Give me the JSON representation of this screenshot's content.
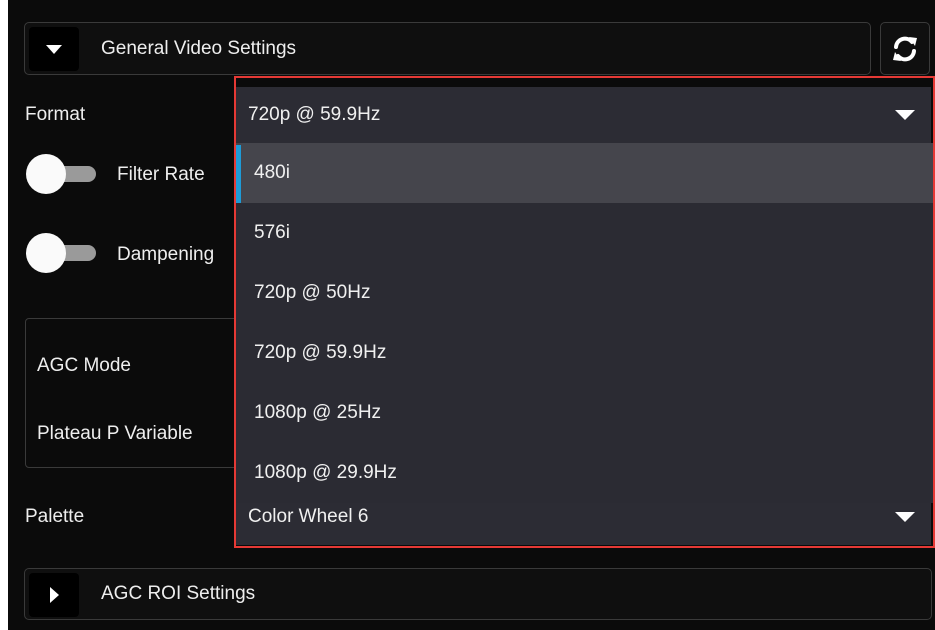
{
  "general_section": {
    "title": "General Video Settings",
    "expanded": true
  },
  "format": {
    "label": "Format",
    "value": "720p @ 59.9Hz",
    "options": [
      "480i",
      "576i",
      "720p @ 50Hz",
      "720p @ 59.9Hz",
      "1080p @ 25Hz",
      "1080p @ 29.9Hz"
    ],
    "highlighted_option": "480i"
  },
  "filter_rate": {
    "label": "Filter Rate",
    "enabled": false
  },
  "dampening": {
    "label": "Dampening",
    "enabled": false
  },
  "agc": {
    "mode_label": "AGC Mode",
    "plateau_label": "Plateau P Variable"
  },
  "palette": {
    "label": "Palette",
    "value": "Color Wheel 6"
  },
  "agc_roi_section": {
    "title": "AGC ROI Settings",
    "expanded": false
  },
  "colors": {
    "accent": "#1e9bd7",
    "highlight_border": "#e53935",
    "background": "#0b0b0b"
  }
}
